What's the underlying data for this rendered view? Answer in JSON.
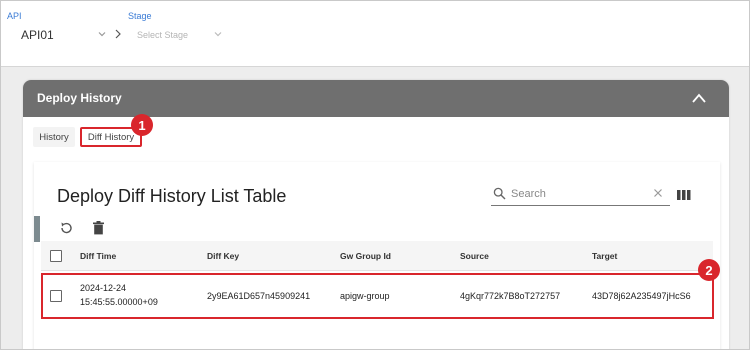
{
  "topbar": {
    "api_label": "API",
    "api_value": "API01",
    "stage_label": "Stage",
    "stage_placeholder": "Select Stage"
  },
  "panel": {
    "title": "Deploy History",
    "tabs": [
      {
        "label": "History",
        "selected": false
      },
      {
        "label": "Diff History",
        "selected": true
      }
    ]
  },
  "annotations": {
    "badge_1": "1",
    "badge_2": "2",
    "color": "#d9262c"
  },
  "card": {
    "title": "Deploy Diff History List Table",
    "search_placeholder": "Search"
  },
  "table": {
    "columns": [
      "Diff Time",
      "Diff Key",
      "Gw Group Id",
      "Source",
      "Target"
    ],
    "rows": [
      {
        "diff_time_date": "2024-12-24",
        "diff_time_time": "15:45:55.00000+09",
        "diff_key": "2y9EA61D657n45909241",
        "gw_group_id": "apigw-group",
        "source": "4gKqr772k7B8oT272757",
        "target": "43D78j62A235497jHcS6"
      }
    ]
  },
  "icons": {
    "api_dropdown": "chevron-down-icon",
    "separator": "chevron-right-icon",
    "stage_dropdown": "chevron-down-icon",
    "collapse": "chevron-up-icon",
    "search": "search-icon",
    "clear": "close-icon",
    "columns": "columns-icon",
    "refresh": "refresh-icon",
    "delete": "trash-icon"
  }
}
